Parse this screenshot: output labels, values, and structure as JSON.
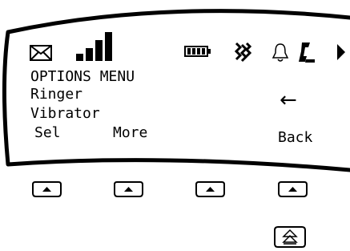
{
  "status_bar": {
    "icons": [
      "envelope-icon",
      "signal-strength-icon",
      "battery-icon",
      "vibrate-icon",
      "bell-icon",
      "phone-icon",
      "arrow-right-icon"
    ]
  },
  "menu": {
    "title": "OPTIONS MENU",
    "items": [
      "Ringer",
      "Vibrator"
    ],
    "back_arrow": "←"
  },
  "softkeys": {
    "left": "Sel",
    "second": "More",
    "right": "Back"
  },
  "buttons": {
    "softkey_icons": [
      "up-triangle-icon",
      "up-triangle-icon",
      "up-triangle-icon",
      "up-triangle-icon"
    ],
    "extra_icon": "double-up-triangle-icon"
  }
}
